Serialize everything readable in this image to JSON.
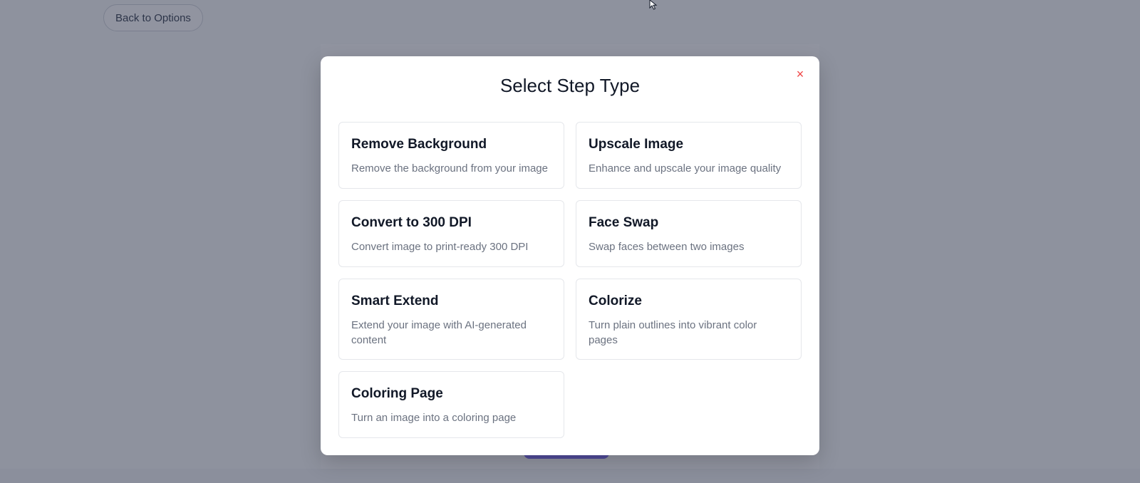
{
  "page": {
    "back_button_label": "Back to Options"
  },
  "modal": {
    "title": "Select Step Type",
    "close_symbol": "×",
    "options": [
      {
        "title": "Remove Background",
        "description": "Remove the background from your image"
      },
      {
        "title": "Upscale Image",
        "description": "Enhance and upscale your image quality"
      },
      {
        "title": "Convert to 300 DPI",
        "description": "Convert image to print-ready 300 DPI"
      },
      {
        "title": "Face Swap",
        "description": "Swap faces between two images"
      },
      {
        "title": "Smart Extend",
        "description": "Extend your image with AI-generated content"
      },
      {
        "title": "Colorize",
        "description": "Turn plain outlines into vibrant color pages"
      },
      {
        "title": "Coloring Page",
        "description": "Turn an image into a coloring page"
      }
    ]
  },
  "colors": {
    "overlay": "#242a42",
    "close": "#ef4444",
    "accent": "#7c6cf0"
  },
  "icons": {
    "close": "close-icon",
    "cursor": "mouse-pointer-icon"
  }
}
